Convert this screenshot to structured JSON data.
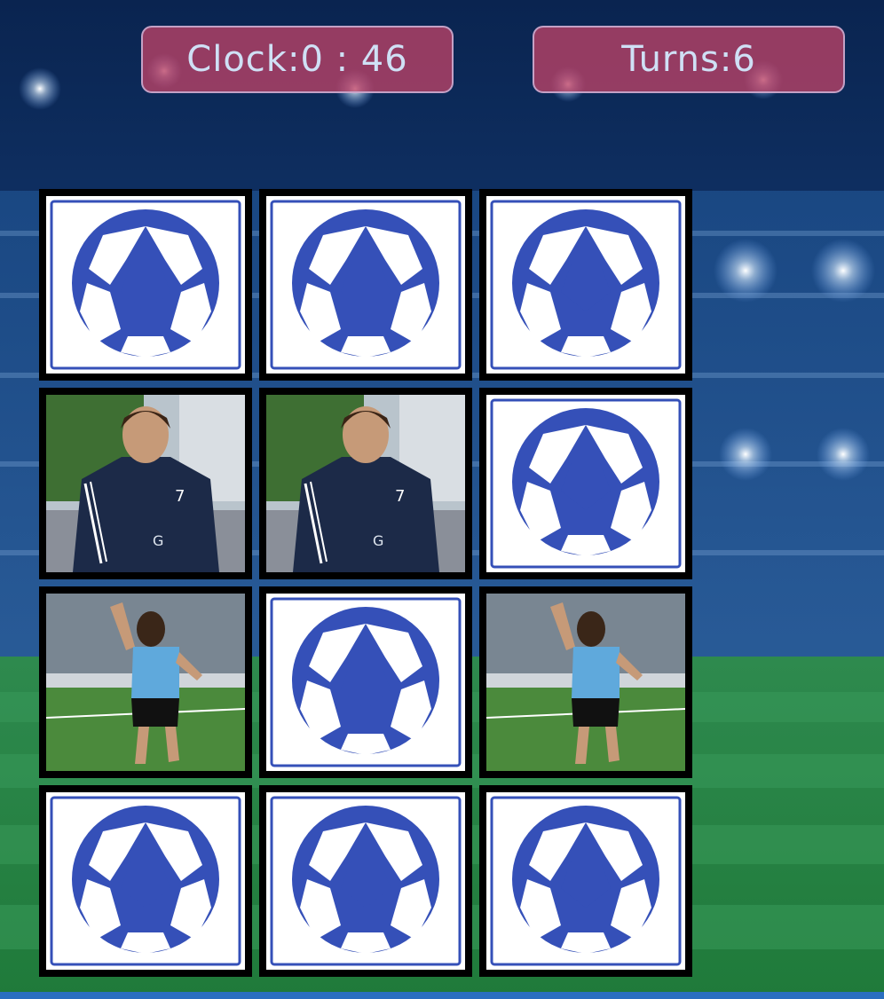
{
  "hud": {
    "clock_label": "Clock:",
    "clock_value": "0 : 46",
    "turns_label": "Turns:",
    "turns_value": "6"
  },
  "board": {
    "columns": 3,
    "cards": [
      {
        "state": "hidden",
        "face": "soccer-ball-icon"
      },
      {
        "state": "hidden",
        "face": "soccer-ball-icon"
      },
      {
        "state": "hidden",
        "face": "soccer-ball-icon"
      },
      {
        "state": "revealed",
        "face": "player-dark-jersey"
      },
      {
        "state": "revealed",
        "face": "player-dark-jersey"
      },
      {
        "state": "hidden",
        "face": "soccer-ball-icon"
      },
      {
        "state": "revealed",
        "face": "player-light-blue-jersey"
      },
      {
        "state": "hidden",
        "face": "soccer-ball-icon"
      },
      {
        "state": "revealed",
        "face": "player-light-blue-jersey"
      },
      {
        "state": "hidden",
        "face": "soccer-ball-icon"
      },
      {
        "state": "hidden",
        "face": "soccer-ball-icon"
      },
      {
        "state": "hidden",
        "face": "soccer-ball-icon"
      }
    ]
  },
  "colors": {
    "card_border": "#000000",
    "ball_blue": "#3550b8",
    "hud_fill": "#bc4266",
    "hud_text": "#cfe0f5"
  }
}
